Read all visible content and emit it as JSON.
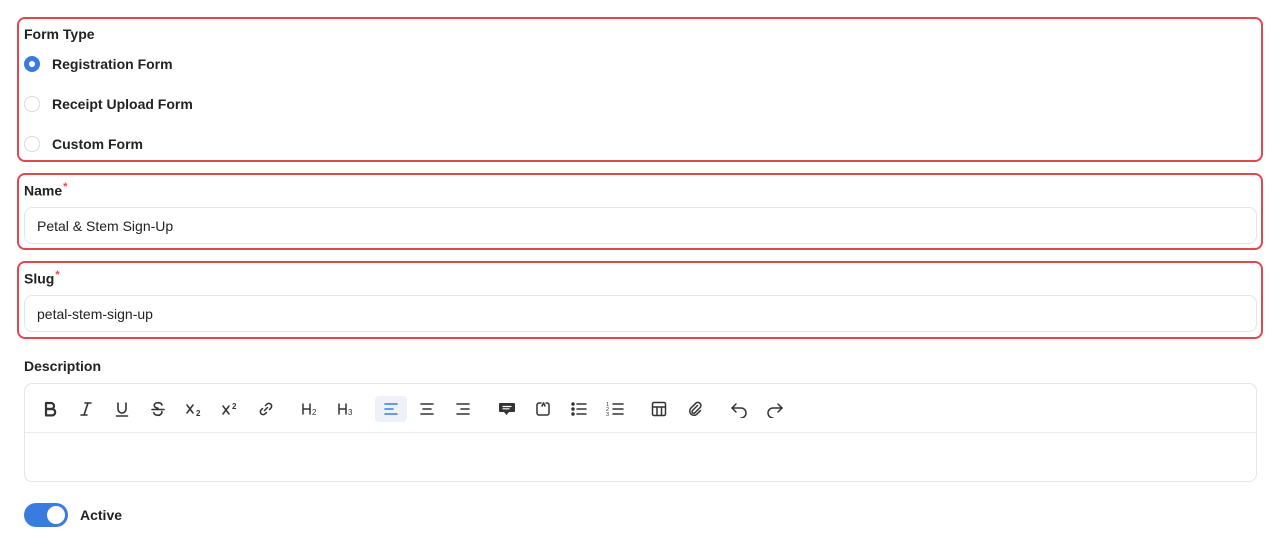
{
  "form_type": {
    "label": "Form Type",
    "options": [
      {
        "label": "Registration Form",
        "checked": true
      },
      {
        "label": "Receipt Upload Form",
        "checked": false
      },
      {
        "label": "Custom Form",
        "checked": false
      }
    ]
  },
  "name": {
    "label": "Name",
    "required_mark": "*",
    "value": "Petal & Stem Sign-Up"
  },
  "slug": {
    "label": "Slug",
    "required_mark": "*",
    "value": "petal-stem-sign-up"
  },
  "description": {
    "label": "Description",
    "toolbar": [
      "bold-icon",
      "italic-icon",
      "underline-icon",
      "strikethrough-icon",
      "subscript-icon",
      "superscript-icon",
      "link-icon",
      "heading-2-icon",
      "heading-3-icon",
      "align-left-icon",
      "align-center-icon",
      "align-right-icon",
      "comment-icon",
      "embed-icon",
      "bullet-list-icon",
      "numbered-list-icon",
      "table-icon",
      "attach-link-icon",
      "undo-icon",
      "redo-icon"
    ],
    "active_tool": "align-left-icon",
    "value": ""
  },
  "active": {
    "label": "Active",
    "on": true
  },
  "colors": {
    "highlight_border": "#de4950",
    "accent": "#3a7be0",
    "required": "#e5484d"
  }
}
